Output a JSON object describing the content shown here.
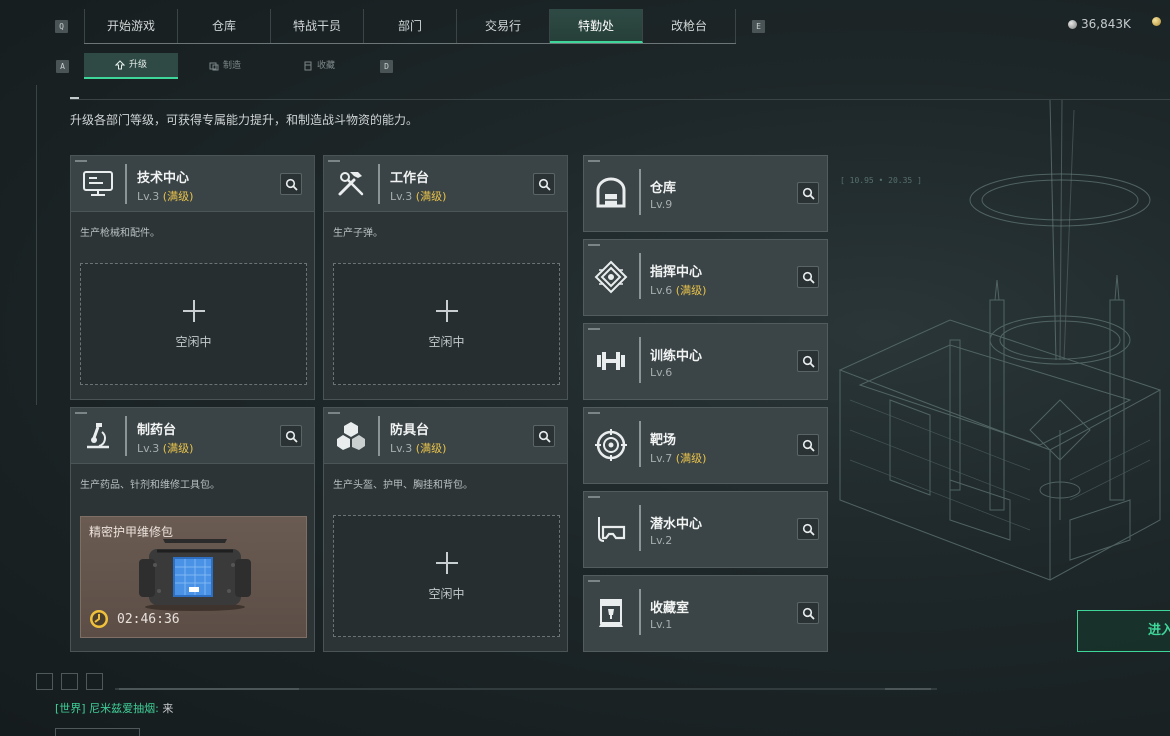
{
  "keys": {
    "prev_tab": "Q",
    "next_tab": "E",
    "prev_sub": "A",
    "next_sub": "D"
  },
  "nav": {
    "tabs": [
      "开始游戏",
      "仓库",
      "特战干员",
      "部门",
      "交易行",
      "特勤处",
      "改枪台"
    ],
    "active": "特勤处"
  },
  "currency": {
    "silver": "36,843K",
    "gold": ""
  },
  "subnav": {
    "items": [
      {
        "label": "升级",
        "icon": "upgrade-icon",
        "active": true
      },
      {
        "label": "制造",
        "icon": "craft-icon",
        "active": false
      },
      {
        "label": "收藏",
        "icon": "collection-icon",
        "active": false
      }
    ]
  },
  "description": "升级各部门等级，可获得专属能力提升，和制造战斗物资的能力。",
  "idle_label": "空闲中",
  "max_label": "(满级)",
  "workshops": [
    {
      "title": "技术中心",
      "level": "Lv.3",
      "desc": "生产枪械和配件。",
      "icon": "monitor-icon"
    },
    {
      "title": "工作台",
      "level": "Lv.3",
      "desc": "生产子弹。",
      "icon": "tools-icon"
    },
    {
      "title": "制药台",
      "level": "Lv.3",
      "desc": "生产药品、针剂和维修工具包。",
      "icon": "microscope-icon",
      "crafting": {
        "item": "精密护甲维修包",
        "time": "02:46:36"
      }
    },
    {
      "title": "防具台",
      "level": "Lv.3",
      "desc": "生产头盔、护甲、胸挂和背包。",
      "icon": "cubes-icon"
    }
  ],
  "facilities": [
    {
      "title": "仓库",
      "level": "Lv.9",
      "max": false,
      "icon": "warehouse-icon"
    },
    {
      "title": "指挥中心",
      "level": "Lv.6",
      "max": true,
      "icon": "command-icon"
    },
    {
      "title": "训练中心",
      "level": "Lv.6",
      "max": false,
      "icon": "dumbbell-icon"
    },
    {
      "title": "靶场",
      "level": "Lv.7",
      "max": true,
      "icon": "target-icon"
    },
    {
      "title": "潜水中心",
      "level": "Lv.2",
      "max": false,
      "icon": "diving-mask-icon"
    },
    {
      "title": "收藏室",
      "level": "Lv.1",
      "max": false,
      "icon": "trophy-case-icon"
    }
  ],
  "enter_button": "进入",
  "coordinates": "[ 10.95 • 20.35 ]",
  "chat": {
    "channel": "[世界]",
    "sender": "尼米兹爱抽烟:",
    "message": "来"
  },
  "colors": {
    "accent": "#3fd69a",
    "max_level": "#e7c24b",
    "panel": "#3a4345"
  }
}
